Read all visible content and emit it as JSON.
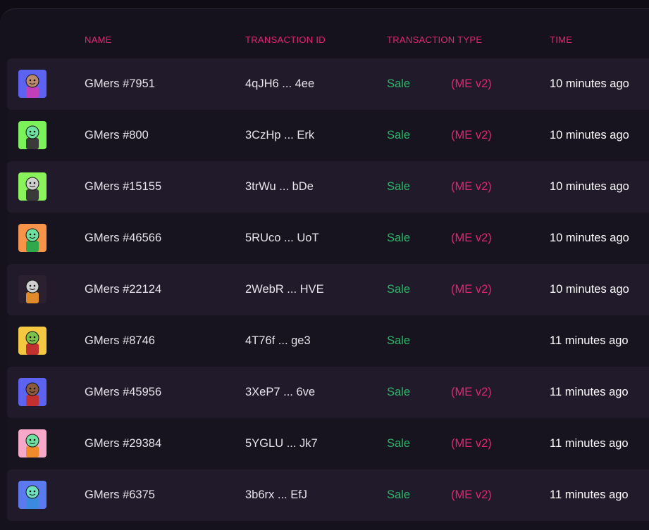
{
  "columns": {
    "name": "NAME",
    "transaction_id": "TRANSACTION ID",
    "transaction_type": "TRANSACTION TYPE",
    "time": "TIME"
  },
  "rows": [
    {
      "name": "GMers #7951",
      "txid": "4qJH6 ... 4ee",
      "type": "Sale",
      "market": "(ME v2)",
      "time": "10 minutes ago",
      "avatar_bg": "#5b63f0",
      "avatar_face": "#b98a6e",
      "avatar_shirt": "#c13fb8"
    },
    {
      "name": "GMers #800",
      "txid": "3CzHp ... Erk",
      "type": "Sale",
      "market": "(ME v2)",
      "time": "10 minutes ago",
      "avatar_bg": "#7cf25a",
      "avatar_face": "#6fe0a0",
      "avatar_shirt": "#3a3a3a"
    },
    {
      "name": "GMers #15155",
      "txid": "3trWu ... bDe",
      "type": "Sale",
      "market": "(ME v2)",
      "time": "10 minutes ago",
      "avatar_bg": "#8af25a",
      "avatar_face": "#cfcfcf",
      "avatar_shirt": "#3a3a3a"
    },
    {
      "name": "GMers #46566",
      "txid": "5RUco ... UoT",
      "type": "Sale",
      "market": "(ME v2)",
      "time": "10 minutes ago",
      "avatar_bg": "#f7944a",
      "avatar_face": "#6fe0a0",
      "avatar_shirt": "#2ea84a"
    },
    {
      "name": "GMers #22124",
      "txid": "2WebR ... HVE",
      "type": "Sale",
      "market": "(ME v2)",
      "time": "10 minutes ago",
      "avatar_bg": "#2a2030",
      "avatar_face": "#cfcfcf",
      "avatar_shirt": "#e08a2a"
    },
    {
      "name": "GMers #8746",
      "txid": "4T76f ... ge3",
      "type": "Sale",
      "market": "",
      "time": "11 minutes ago",
      "avatar_bg": "#f5c842",
      "avatar_face": "#7cc24a",
      "avatar_shirt": "#c23030"
    },
    {
      "name": "GMers #45956",
      "txid": "3XeP7 ... 6ve",
      "type": "Sale",
      "market": "(ME v2)",
      "time": "11 minutes ago",
      "avatar_bg": "#5b63f0",
      "avatar_face": "#8a5a3a",
      "avatar_shirt": "#c23030"
    },
    {
      "name": "GMers #29384",
      "txid": "5YGLU ... Jk7",
      "type": "Sale",
      "market": "(ME v2)",
      "time": "11 minutes ago",
      "avatar_bg": "#f7a8c8",
      "avatar_face": "#6fe0a0",
      "avatar_shirt": "#f08a2a"
    },
    {
      "name": "GMers #6375",
      "txid": "3b6rx ... EfJ",
      "type": "Sale",
      "market": "(ME v2)",
      "time": "11 minutes ago",
      "avatar_bg": "#5b7af0",
      "avatar_face": "#6fe0c0",
      "avatar_shirt": "#3a8ae0"
    }
  ]
}
